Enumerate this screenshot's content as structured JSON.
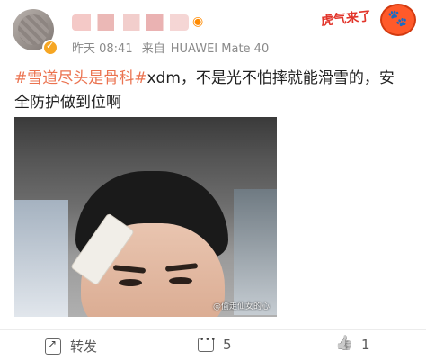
{
  "header": {
    "timestamp": "昨天 08:41",
    "source_prefix": "来自",
    "device": "HUAWEI Mate 40",
    "sticker_text": "虎气来了"
  },
  "post": {
    "topic1": "#雪道尽头是骨科#",
    "body_line1": "xdm，不是光不怕摔就能滑雪的，安",
    "body_line2": "全防护做到位啊"
  },
  "photo": {
    "watermark": "@偷走仙女的心"
  },
  "actions": {
    "share_label": "转发",
    "comment_count": "5",
    "like_count": "1"
  },
  "colors": {
    "topic": "#eb7350",
    "meta": "#8a8a8a"
  }
}
